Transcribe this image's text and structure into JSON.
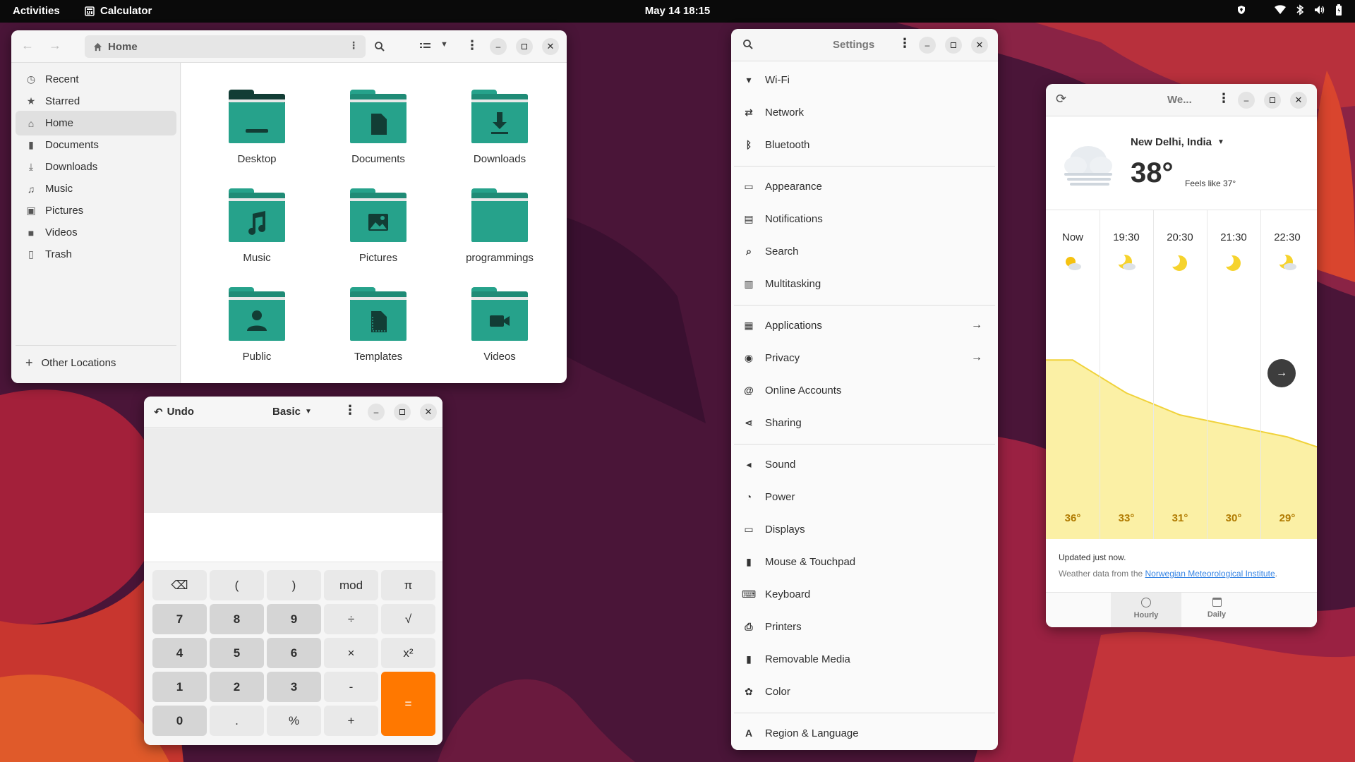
{
  "topbar": {
    "activities": "Activities",
    "app_name": "Calculator",
    "clock": "May 14  18:15"
  },
  "files": {
    "path": "Home",
    "sidebar": [
      {
        "label": "Recent",
        "icon": "clock-icon"
      },
      {
        "label": "Starred",
        "icon": "star-icon"
      },
      {
        "label": "Home",
        "icon": "home-icon",
        "selected": true
      },
      {
        "label": "Documents",
        "icon": "document-icon"
      },
      {
        "label": "Downloads",
        "icon": "download-icon"
      },
      {
        "label": "Music",
        "icon": "music-icon"
      },
      {
        "label": "Pictures",
        "icon": "picture-icon"
      },
      {
        "label": "Videos",
        "icon": "video-icon"
      },
      {
        "label": "Trash",
        "icon": "trash-icon"
      }
    ],
    "other_locations": "Other Locations",
    "folders": [
      {
        "name": "Desktop",
        "glyph": "desktop"
      },
      {
        "name": "Documents",
        "glyph": "document"
      },
      {
        "name": "Downloads",
        "glyph": "download"
      },
      {
        "name": "Music",
        "glyph": "music"
      },
      {
        "name": "Pictures",
        "glyph": "picture"
      },
      {
        "name": "programmings",
        "glyph": "none"
      },
      {
        "name": "Public",
        "glyph": "person"
      },
      {
        "name": "Templates",
        "glyph": "template"
      },
      {
        "name": "Videos",
        "glyph": "video"
      }
    ]
  },
  "calculator": {
    "undo": "Undo",
    "mode": "Basic",
    "buttons": [
      [
        "⌫",
        "(",
        ")",
        "mod",
        "π"
      ],
      [
        "7",
        "8",
        "9",
        "÷",
        "√"
      ],
      [
        "4",
        "5",
        "6",
        "×",
        "x²"
      ],
      [
        "1",
        "2",
        "3",
        "-",
        "="
      ],
      [
        "0",
        ".",
        "%",
        "+"
      ]
    ]
  },
  "settings": {
    "title": "Settings",
    "groups": [
      [
        {
          "label": "Wi-Fi",
          "icon": "wifi-icon"
        },
        {
          "label": "Network",
          "icon": "network-icon"
        },
        {
          "label": "Bluetooth",
          "icon": "bluetooth-icon"
        }
      ],
      [
        {
          "label": "Appearance",
          "icon": "appearance-icon"
        },
        {
          "label": "Notifications",
          "icon": "notifications-icon"
        },
        {
          "label": "Search",
          "icon": "search-icon"
        },
        {
          "label": "Multitasking",
          "icon": "multitasking-icon"
        }
      ],
      [
        {
          "label": "Applications",
          "icon": "applications-icon",
          "arrow": true
        },
        {
          "label": "Privacy",
          "icon": "privacy-icon",
          "arrow": true
        },
        {
          "label": "Online Accounts",
          "icon": "online-accounts-icon"
        },
        {
          "label": "Sharing",
          "icon": "sharing-icon"
        }
      ],
      [
        {
          "label": "Sound",
          "icon": "sound-icon"
        },
        {
          "label": "Power",
          "icon": "power-icon"
        },
        {
          "label": "Displays",
          "icon": "displays-icon"
        },
        {
          "label": "Mouse & Touchpad",
          "icon": "mouse-icon"
        },
        {
          "label": "Keyboard",
          "icon": "keyboard-icon"
        },
        {
          "label": "Printers",
          "icon": "printer-icon"
        },
        {
          "label": "Removable Media",
          "icon": "usb-icon"
        },
        {
          "label": "Color",
          "icon": "color-icon"
        }
      ],
      [
        {
          "label": "Region & Language",
          "icon": "language-icon"
        }
      ]
    ]
  },
  "weather": {
    "title": "We...",
    "location": "New Delhi, India",
    "temperature": "38°",
    "feels_like": "Feels like 37°",
    "hours": [
      "Now",
      "19:30",
      "20:30",
      "21:30",
      "22:30"
    ],
    "hour_icons": [
      "sun-cloud-icon",
      "moon-cloud-icon",
      "moon-icon",
      "moon-icon",
      "moon-cloud-icon"
    ],
    "temps": [
      "36°",
      "33°",
      "31°",
      "30°",
      "29°"
    ],
    "chart_data": {
      "type": "area",
      "x": [
        "Now",
        "19:30",
        "20:30",
        "21:30",
        "22:30"
      ],
      "values": [
        36,
        33,
        31,
        30,
        29
      ]
    },
    "updated": "Updated just now.",
    "source_prefix": "Weather data from the ",
    "source_link": "Norwegian Meteorological Institute",
    "source_suffix": ".",
    "tabs": [
      {
        "label": "Hourly"
      },
      {
        "label": "Daily"
      }
    ]
  }
}
